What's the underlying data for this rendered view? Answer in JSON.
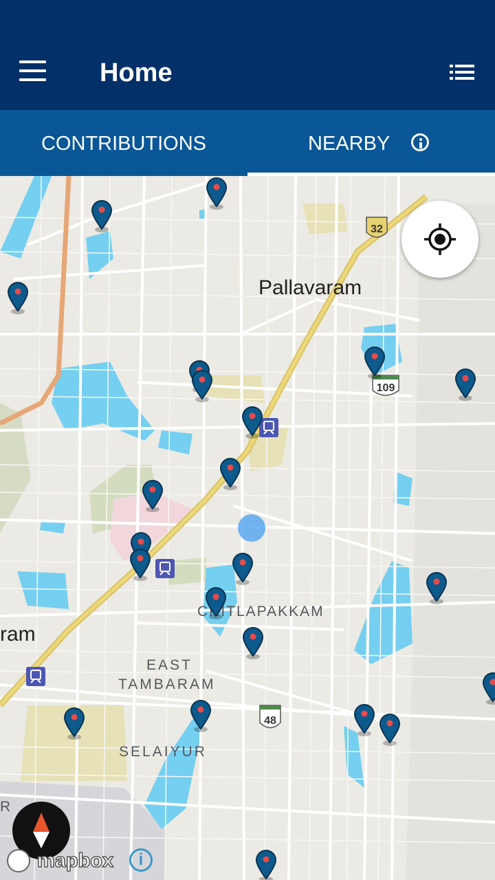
{
  "app_bar": {
    "title": "Home",
    "menu_icon": "hamburger-menu-icon",
    "list_icon": "list-view-icon",
    "background": "#033068"
  },
  "tabs": [
    {
      "label": "CONTRIBUTIONS",
      "selected": false
    },
    {
      "label": "NEARBY",
      "selected": true,
      "icon": "info-icon"
    }
  ],
  "tab_bar_color": "#0a5797",
  "map": {
    "labels": {
      "pallavaram": "Pallavaram",
      "ram": "ram",
      "chitlapakkam": "CHITLAPAKKAM",
      "east": "EAST",
      "tambaram": "TAMBARAM",
      "selaiyur": "SELAIYUR",
      "r": "R"
    },
    "route_shields": [
      "32",
      "109",
      "48"
    ],
    "pin_color": "#0d5a8c",
    "water_color": "#75cff0",
    "attribution": "mapbox",
    "controls": {
      "locate": "my-location-icon",
      "compass": "compass-icon",
      "info": "i"
    }
  }
}
